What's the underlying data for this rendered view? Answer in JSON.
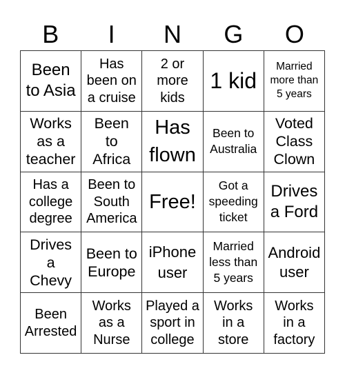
{
  "title_letters": [
    "B",
    "I",
    "N",
    "G",
    "O"
  ],
  "cells": [
    [
      "Been to Asia",
      "Has been on a cruise",
      "2 or more kids",
      "1 kid",
      "Married more than 5 years"
    ],
    [
      "Works as a teacher",
      "Been to Africa",
      "Has flown",
      "Been to Australia",
      "Voted Class Clown"
    ],
    [
      "Has a college degree",
      "Been to South America",
      "Free!",
      "Got a speeding ticket",
      "Drives a Ford"
    ],
    [
      "Drives a Chevy",
      "Been to Europe",
      "iPhone user",
      "Married less than 5 years",
      "Android user"
    ],
    [
      "Been Arrested",
      "Works as a Nurse",
      "Played a sport in college",
      "Works in a store",
      "Works in a factory"
    ]
  ],
  "colors": {
    "grid_line": "#333333",
    "text": "#000000",
    "background": "#ffffff"
  }
}
